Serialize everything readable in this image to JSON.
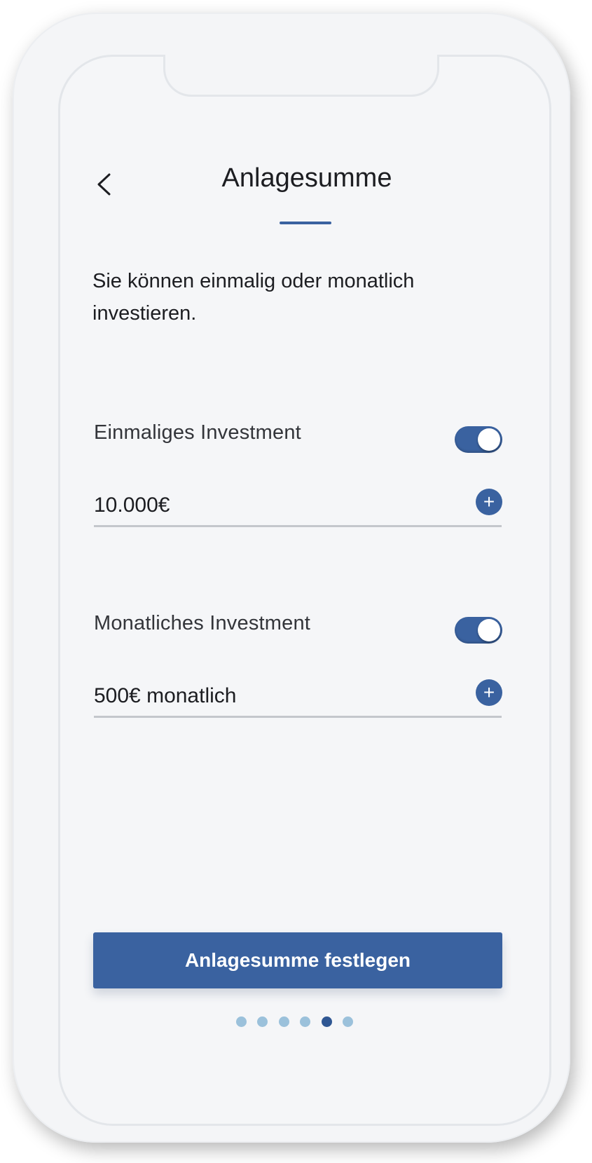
{
  "header": {
    "title": "Anlagesumme",
    "back_icon": "chevron-left-icon"
  },
  "intro_text": "Sie können einmalig oder monatlich investieren.",
  "one_time": {
    "label": "Einmaliges Investment",
    "toggle_on": true,
    "value": "10.000€",
    "add_label": "+"
  },
  "monthly": {
    "label": "Monatliches Investment",
    "toggle_on": true,
    "value": "500€ monatlich",
    "add_label": "+"
  },
  "primary_button": {
    "label": "Anlagesumme festlegen"
  },
  "pager": {
    "total": 6,
    "active_index": 4
  },
  "colors": {
    "accent": "#3a62a0",
    "dot_inactive": "#9bc1db",
    "dot_active": "#2f5793"
  }
}
